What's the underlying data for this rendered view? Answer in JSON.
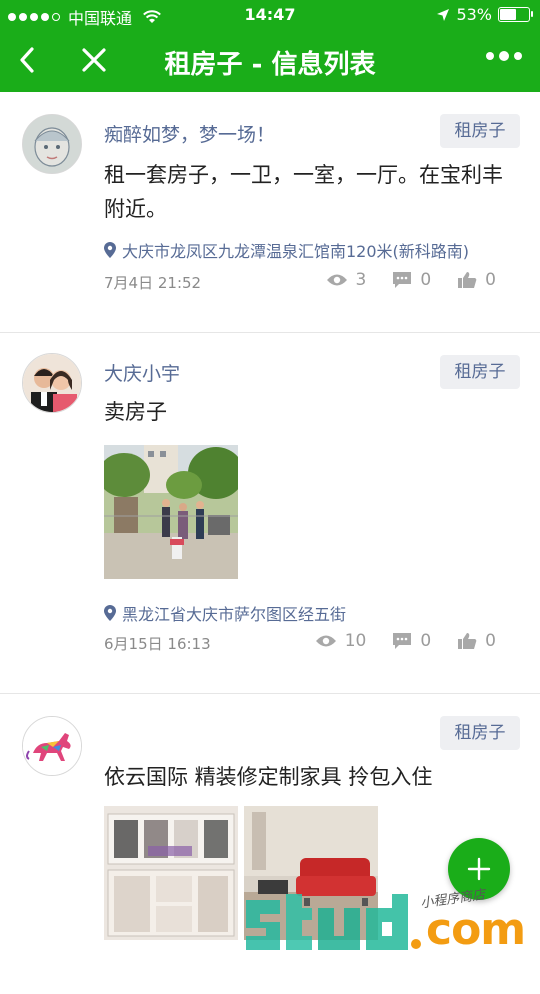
{
  "status_bar": {
    "carrier": "中国联通",
    "time": "14:47",
    "battery": "53%",
    "battery_level": 0.53
  },
  "nav": {
    "title": "租房子 - 信息列表",
    "back_icon": "chevron-left-icon",
    "close_icon": "close-icon",
    "more_icon": "more-dots-icon"
  },
  "posts": [
    {
      "username": "痴醉如梦，梦一场！",
      "tag": "租房子",
      "content": "租一套房子，一卫，一室，一厅。在宝利丰附近。",
      "location": "大庆市龙凤区九龙潭温泉汇馆南120米(新科路南)",
      "date": "7月4日 21:52",
      "views": "3",
      "comments": "0",
      "likes": "0"
    },
    {
      "username": "大庆小宇",
      "tag": "租房子",
      "content": "卖房子",
      "location": "黑龙江省大庆市萨尔图区经五街",
      "date": "6月15日 16:13",
      "views": "10",
      "comments": "0",
      "likes": "0"
    },
    {
      "username": "",
      "tag": "租房子",
      "content": "依云国际 精装修定制家具 拎包入住"
    }
  ],
  "fab": {
    "label": "+"
  },
  "watermark": {
    "text": "com",
    "subtext": "小程序商店"
  },
  "colors": {
    "brand_green": "#1aad19",
    "link_blue": "#576b95",
    "tag_bg": "#eeeff2",
    "meta_gray": "#8a8a8a"
  }
}
